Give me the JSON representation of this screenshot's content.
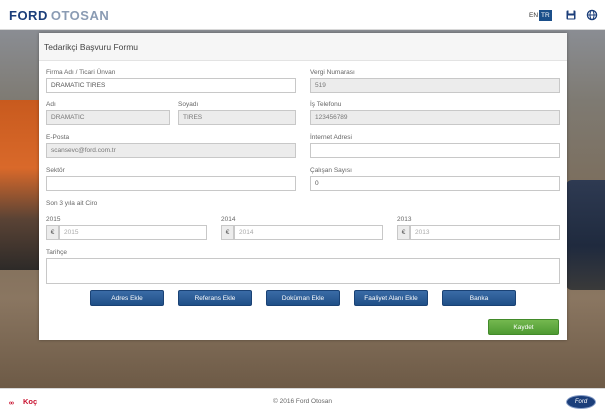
{
  "header": {
    "brand_ford": "FORD",
    "brand_otosan": "OTOSAN",
    "lang_en": "EN",
    "lang_tr": "TR"
  },
  "form": {
    "title": "Tedarikçi Başvuru Formu",
    "firma_label": "Firma Adı / Ticari Ünvan",
    "firma_value": "DRAMATIC TIRES",
    "vergi_label": "Vergi Numarası",
    "vergi_value": "519",
    "adi_label": "Adı",
    "adi_value": "DRAMATIC",
    "soyadi_label": "Soyadı",
    "soyadi_value": "TIRES",
    "is_tel_label": "İş Telefonu",
    "is_tel_value": "123456789",
    "eposta_label": "E-Posta",
    "eposta_value": "scansevc@ford.com.tr",
    "internet_label": "İnternet Adresi",
    "internet_value": "",
    "sektor_label": "Sektör",
    "sektor_value": "",
    "calisan_label": "Çalışan Sayısı",
    "calisan_value": "0",
    "ciro_label": "Son 3 yıla ait Ciro",
    "years": [
      {
        "label": "2015",
        "currency": "€",
        "placeholder": "2015"
      },
      {
        "label": "2014",
        "currency": "€",
        "placeholder": "2014"
      },
      {
        "label": "2013",
        "currency": "€",
        "placeholder": "2013"
      }
    ],
    "tarihce_label": "Tarihçe",
    "tarihce_value": ""
  },
  "buttons": {
    "adres": "Adres Ekle",
    "referans": "Referans Ekle",
    "dokuman": "Doküman Ekle",
    "faaliyet": "Faaliyet Alanı Ekle",
    "banka": "Banka",
    "kaydet": "Kaydet"
  },
  "footer": {
    "koc": "Koç",
    "copyright": "© 2016 Ford Otosan",
    "ford_logo": "Ford"
  },
  "colors": {
    "brand_blue": "#1b3e7a",
    "button_blue": "#2a5d98",
    "save_green": "#5aa83c",
    "lang_active": "#1b4f8a"
  },
  "icons": {
    "save": "floppy-disk-icon",
    "language": "globe-icon"
  }
}
